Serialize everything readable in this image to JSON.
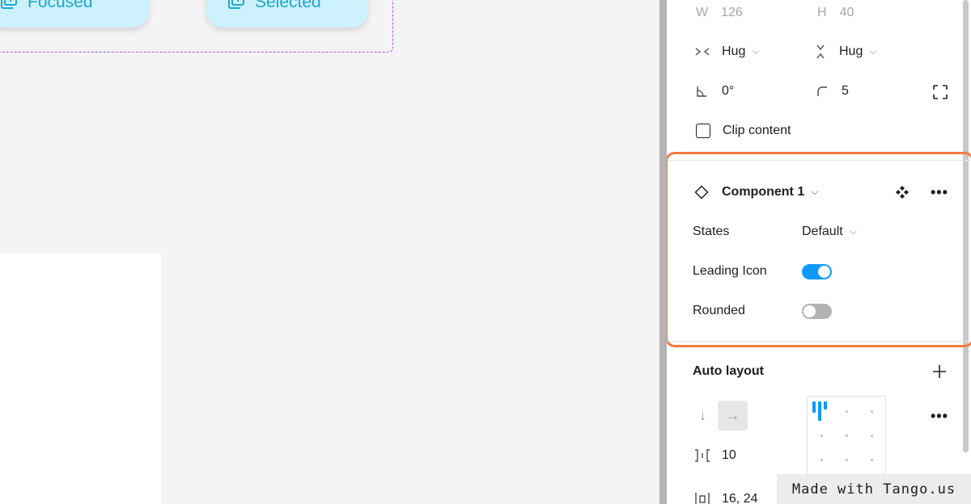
{
  "canvas": {
    "states": [
      {
        "label": "Focused",
        "icon": "add-to-library-icon"
      },
      {
        "label": "Selected",
        "icon": "add-to-library-icon"
      }
    ],
    "colors": {
      "pill_bg": "#cdf1fd",
      "pill_text": "#1ea7d0",
      "selection_dash": "#a259ff"
    }
  },
  "design": {
    "width_label": "W",
    "width_value": "126",
    "height_label": "H",
    "height_value": "40",
    "resize_h_value": "Hug",
    "resize_v_value": "Hug",
    "rotation_value": "0°",
    "radius_value": "5",
    "clip_content_label": "Clip content",
    "clip_content_checked": false
  },
  "component": {
    "name": "Component 1",
    "highlight_color": "#f47a3d",
    "properties": [
      {
        "label": "States",
        "type": "dropdown",
        "value": "Default"
      },
      {
        "label": "Leading Icon",
        "type": "toggle",
        "value": true
      },
      {
        "label": "Rounded",
        "type": "toggle",
        "value": false
      }
    ]
  },
  "auto_layout": {
    "title": "Auto layout",
    "direction": "horizontal",
    "spacing_value": "10",
    "padding_value": "16, 24"
  },
  "watermark": {
    "text": "Made with Tango.us"
  }
}
